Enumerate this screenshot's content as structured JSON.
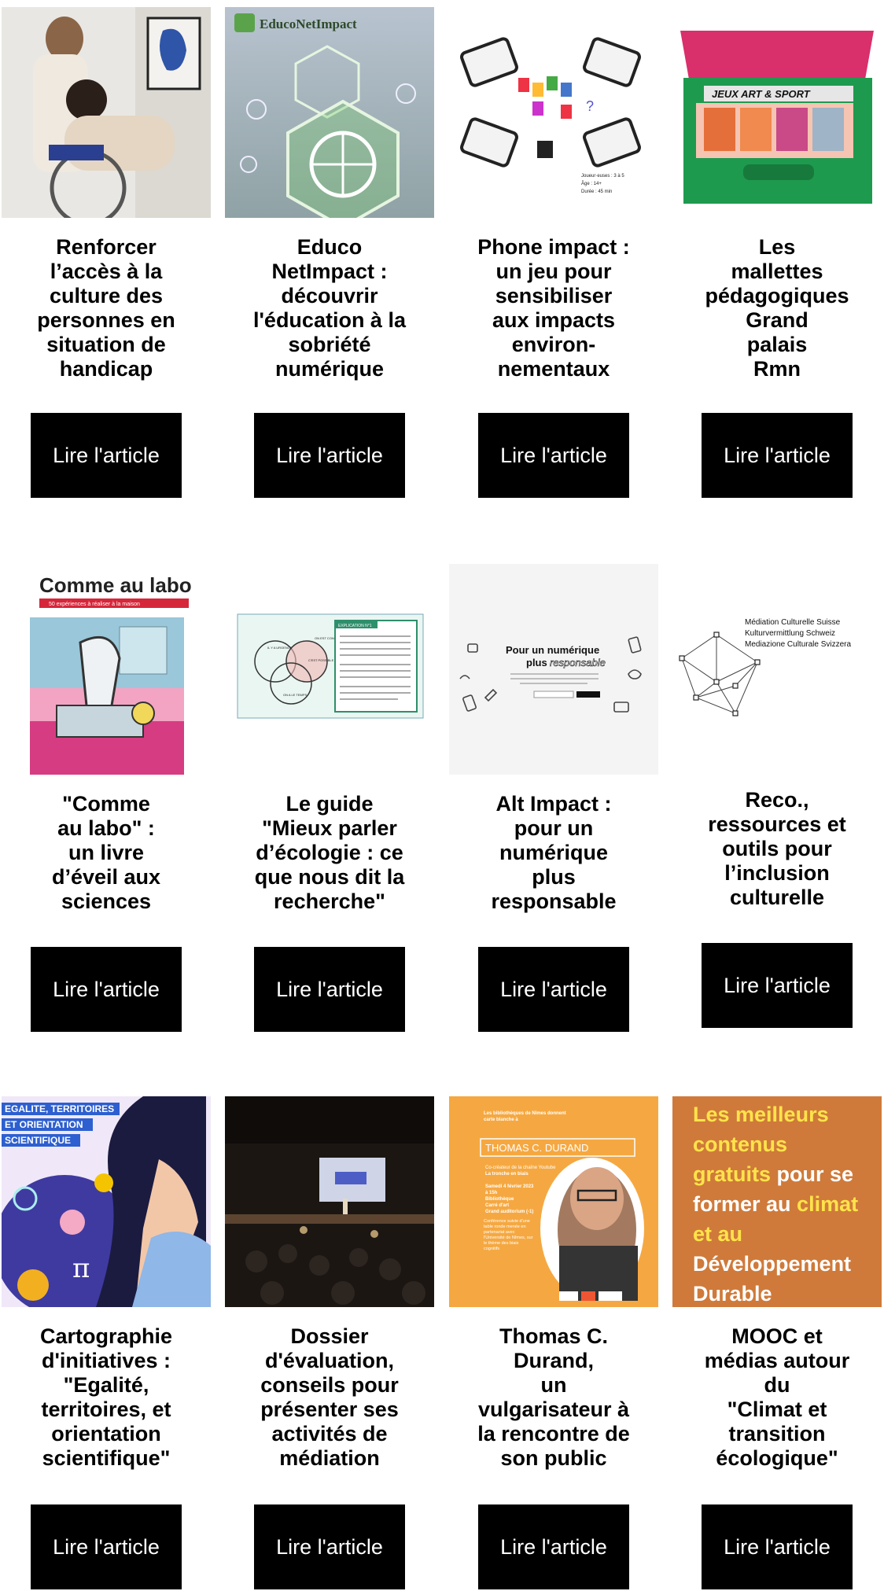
{
  "colors": {
    "button_bg": "#000000",
    "button_text": "#ffffff",
    "background": "#ffffff",
    "mooc_bg": "#cf7a3a",
    "mooc_yellow": "#ffe34a",
    "durand_bg": "#f5a841"
  },
  "cards": [
    {
      "title_lines": [
        "Renforcer",
        "l’accès à la",
        "culture des",
        "personnes en",
        "situation de",
        "handicap"
      ],
      "button": "Lire l'article",
      "image": {
        "description_icon": "wheelchair-photo"
      }
    },
    {
      "title_lines": [
        "Educo",
        "NetImpact :",
        "découvrir",
        "l'éducation à la",
        "sobriété",
        "numérique"
      ],
      "button": "Lire l'article",
      "image": {
        "logo_text": "EducoNetImpact"
      }
    },
    {
      "title_lines": [
        "Phone impact :",
        "un jeu pour",
        "sensibiliser",
        "aux impacts",
        "environ-",
        "nementaux"
      ],
      "button": "Lire l'article",
      "image": {
        "legend": [
          "Joueur·euses : 3 à 5",
          "Âge : 14+",
          "Durée : 45 min"
        ]
      }
    },
    {
      "title_lines": [
        "Les",
        "mallettes",
        "pédagogiques",
        "Grand",
        "palais",
        "Rmn"
      ],
      "button": "Lire l'article",
      "image": {
        "box_label": "JEUX ART & SPORT"
      }
    },
    {
      "title_lines": [
        "\"Comme",
        "au labo\" :",
        "un livre",
        "d’éveil aux",
        "sciences"
      ],
      "button": "Lire l'article",
      "image": {
        "book_title": "Comme au labo",
        "subtitle": "50 expériences à réaliser à la maison"
      }
    },
    {
      "title_lines": [
        "Le guide",
        "\"Mieux parler",
        "d’écologie : ce",
        "que nous dit la",
        "recherche\""
      ],
      "button": "Lire l'article",
      "image": {
        "venn": [
          "IL Y A URGENCE",
          "C'EST POSSIBLE",
          "ON A LE TEMPS",
          "ON EST CONCERNÉ·ES"
        ],
        "box_title": "EXPLICATION N°1"
      }
    },
    {
      "title_lines": [
        "Alt Impact :",
        "pour un",
        "numérique",
        "plus",
        "responsable"
      ],
      "button": "Lire l'article",
      "image": {
        "headline_a": "Pour un numérique",
        "headline_b": "plus",
        "headline_c": "responsable"
      }
    },
    {
      "title_lines": [
        "Reco.,",
        "ressources et",
        "outils pour",
        "l’inclusion",
        "culturelle"
      ],
      "button": "Lire l'article",
      "image": {
        "org_lines": [
          "Médiation Culturelle Suisse",
          "Kulturvermittlung Schweiz",
          "Mediazione Culturale Svizzera"
        ]
      }
    },
    {
      "title_lines": [
        "Cartographie",
        "d'initiatives :",
        "\"Egalité,",
        "territoires, et",
        "orientation",
        "scientifique\""
      ],
      "button": "Lire l'article",
      "image": {
        "banner_lines": [
          "EGALITE, TERRITOIRES",
          "ET ORIENTATION",
          "SCIENTIFIQUE"
        ]
      }
    },
    {
      "title_lines": [
        "Dossier",
        "d'évaluation,",
        "conseils pour",
        "présenter ses",
        "activités de",
        "médiation"
      ],
      "button": "Lire l'article",
      "image": {
        "description_icon": "conference-stage-photo"
      }
    },
    {
      "title_lines": [
        "Thomas C.",
        "Durand,",
        "un",
        "vulgarisateur à",
        "la rencontre de",
        "son public"
      ],
      "button": "Lire l'article",
      "image": {
        "intro": "Les bibliothèques de Nîmes donnent carte blanche à",
        "name": "THOMAS C. DURAND",
        "role_a": "Co-créateur de la chaîne Youtube",
        "role_b": "La tronche en biais",
        "date": "Samedi 4 février 2023",
        "time": "à 15h",
        "place_a": "Bibliothèque",
        "place_b": "Carré d'art",
        "place_c": "Grand auditorium (-1)",
        "conf": "Conférence suivie d'une table ronde menée en partenariat avec l'Université de Nîmes, sur le thème des biais cognitifs"
      }
    },
    {
      "title_lines": [
        "MOOC et",
        "médias autour",
        "du",
        "\"Climat et",
        "transition",
        "écologique\""
      ],
      "button": "Lire l'article",
      "image": {
        "lines": [
          {
            "text": "Les meilleurs",
            "color": "yellow"
          },
          {
            "text": "contenus",
            "color": "yellow"
          },
          {
            "text": "gratuits pour se",
            "color": "mixed"
          },
          {
            "text": "former au climat",
            "color": "mixed2"
          },
          {
            "text": "et au",
            "color": "yellow"
          },
          {
            "text": "Développement",
            "color": "white"
          },
          {
            "text": "Durable",
            "color": "white"
          }
        ]
      }
    }
  ]
}
